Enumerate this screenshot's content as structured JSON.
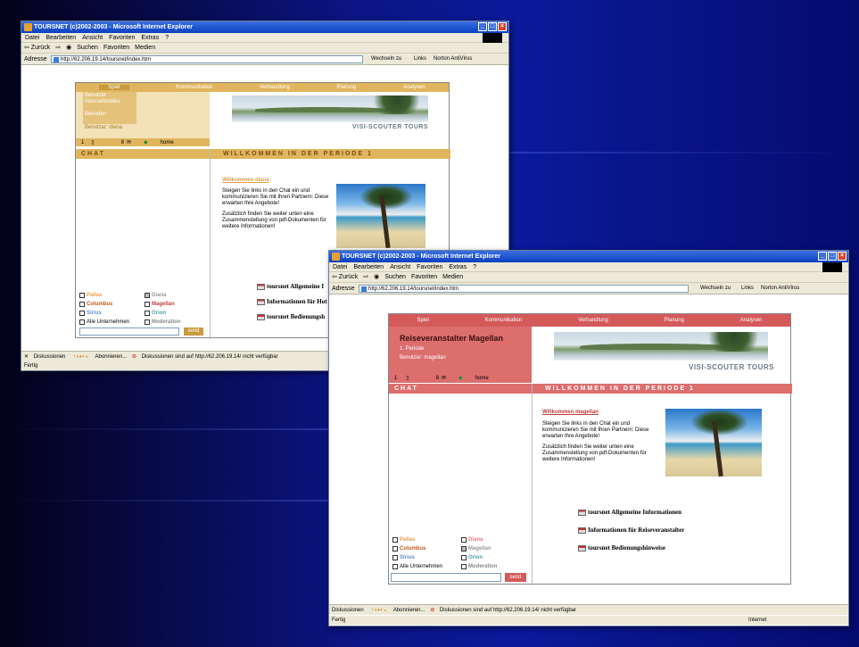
{
  "colors": {
    "w1_accent": "#e0b55e",
    "w2_accent": "#d45a5a",
    "w2_header": "#dc6e6e"
  },
  "browser": {
    "title": "TOURSNET (c)2002-2003 - Microsoft Internet Explorer",
    "menu": [
      "Datei",
      "Bearbeiten",
      "Ansicht",
      "Favoriten",
      "Extras",
      "?"
    ],
    "toolbar": [
      "⇦ Zurück",
      "⇨",
      "◉",
      "Suchen",
      "Favoriten",
      "Medien"
    ],
    "address_label": "Adresse",
    "url": "http://62.206.19.14/toursnet/index.htm",
    "go_label": "Wechseln zu",
    "links_label": "Links",
    "norton_label": "Norton AntiVirus",
    "discussion_label": "Diskussionen",
    "subscribe_label": "Abonnieren...",
    "discussion_msg": "Diskussionen sind auf http://62.206.19.14/ nicht verfügbar",
    "status_ready": "Fertig",
    "status_zone": "Internet"
  },
  "site": {
    "nav": [
      "Spiel",
      "Kommunikation",
      "Verhandlung",
      "Planung",
      "Analysen"
    ],
    "brand": "VISI-SCOUTER TOURS",
    "home_label": "home",
    "mail_label": "8",
    "chat_heading": "CHAT",
    "welcome_heading": "WILLKOMMEN IN DER PERIODE 1",
    "intro_p1": "Steigen Sie links in den Chat ein und kommunizieren Sie mit Ihren Partnern: Diese erwarten Ihre Angebote!",
    "intro_p2": "Zusätzlich finden Sie weiter unten eine Zusammenstellung von pdf-Dokumenten für weitere Informationen!",
    "send_label": "send",
    "w1_links": [
      "toursnet Allgemeine I",
      "Informationen für Hot",
      "toursnet Bedienungsh"
    ],
    "w2_links": [
      "toursnet Allgemeine Informationen",
      "Informationen für Reiseveranstalter",
      "toursnet Bedienungshinweise"
    ]
  },
  "window1": {
    "dropdown": [
      "Benutzer",
      "Internationales",
      "",
      "Beenden"
    ],
    "user_line": "Benutzer: diana",
    "welcome_user": "Willkommen diana",
    "users": [
      {
        "name": "Pallas",
        "color": "#e0a050",
        "checked": false
      },
      {
        "name": "Diana",
        "color": "#999999",
        "checked": true
      },
      {
        "name": "Columbus",
        "color": "#c05a1c",
        "checked": false
      },
      {
        "name": "Magellan",
        "color": "#c04040",
        "checked": false
      },
      {
        "name": "Sirius",
        "color": "#6090c0",
        "checked": false
      },
      {
        "name": "Orion",
        "color": "#50a0b0",
        "checked": false
      },
      {
        "name": "Alle Unternehmen",
        "color": "#000000",
        "checked": false
      },
      {
        "name": "Moderation",
        "color": "#888888",
        "checked": false
      }
    ]
  },
  "window2": {
    "company": "Reiseveranstalter Magellan",
    "period": "1. Periode",
    "user_line": "Benutzer: magellan",
    "welcome_user": "Willkommen magellan",
    "users": [
      {
        "name": "Pallas",
        "color": "#e0a050",
        "checked": false
      },
      {
        "name": "Diana",
        "color": "#e08080",
        "checked": false
      },
      {
        "name": "Columbus",
        "color": "#c05a1c",
        "checked": false
      },
      {
        "name": "Magellan",
        "color": "#999999",
        "checked": true
      },
      {
        "name": "Sirius",
        "color": "#6090c0",
        "checked": false
      },
      {
        "name": "Orion",
        "color": "#50a0b0",
        "checked": false
      },
      {
        "name": "Alle Unternehmen",
        "color": "#000000",
        "checked": false
      },
      {
        "name": "Moderation",
        "color": "#888888",
        "checked": false
      }
    ]
  }
}
